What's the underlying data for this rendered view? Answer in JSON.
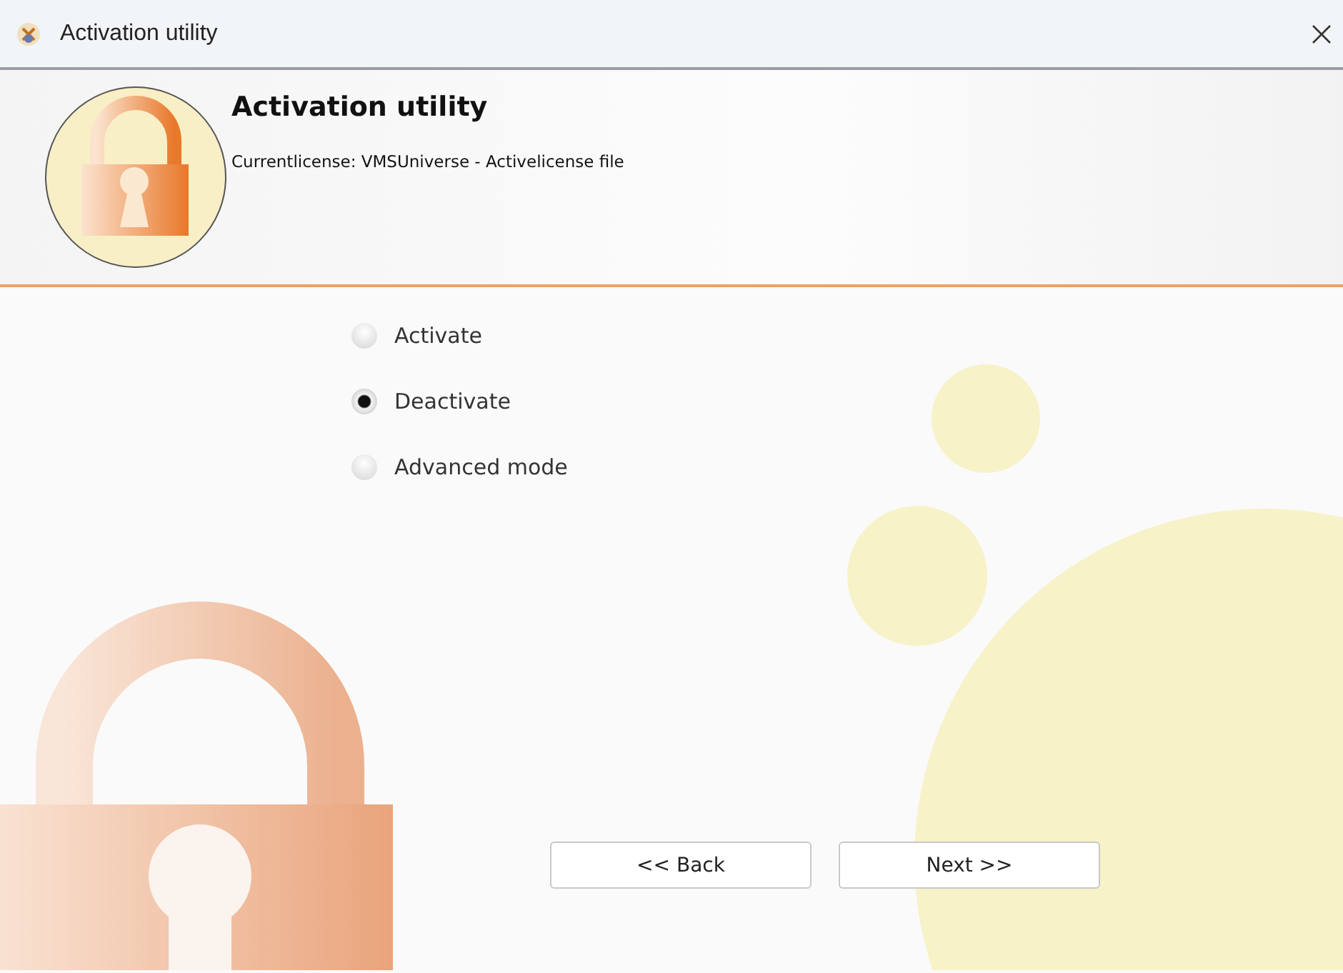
{
  "window": {
    "title": "Activation utility"
  },
  "header": {
    "title": "Activation utility",
    "license": "Currentlicense: VMSUniverse - Activelicense file"
  },
  "options": [
    {
      "label": "Activate",
      "selected": false
    },
    {
      "label": "Deactivate",
      "selected": true
    },
    {
      "label": "Advanced mode",
      "selected": false
    }
  ],
  "buttons": [
    "<< Back",
    "Next >>"
  ]
}
